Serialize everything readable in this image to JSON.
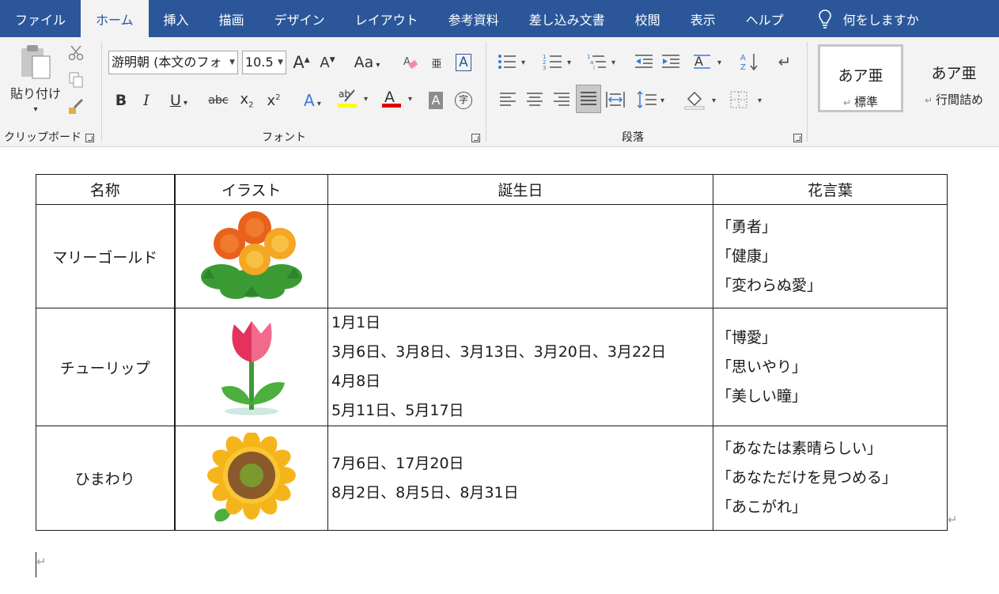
{
  "tabs": [
    {
      "label": "ファイル",
      "active": false
    },
    {
      "label": "ホーム",
      "active": true
    },
    {
      "label": "挿入",
      "active": false
    },
    {
      "label": "描画",
      "active": false
    },
    {
      "label": "デザイン",
      "active": false
    },
    {
      "label": "レイアウト",
      "active": false
    },
    {
      "label": "参考資料",
      "active": false
    },
    {
      "label": "差し込み文書",
      "active": false
    },
    {
      "label": "校閲",
      "active": false
    },
    {
      "label": "表示",
      "active": false
    },
    {
      "label": "ヘルプ",
      "active": false
    }
  ],
  "tell_me": {
    "label": "何をしますか",
    "icon": "lightbulb-icon"
  },
  "ribbon": {
    "clipboard": {
      "label": "クリップボード",
      "paste_label": "貼り付け"
    },
    "font": {
      "label": "フォント",
      "font_name": "游明朝 (本文のフォ",
      "font_size": "10.5"
    },
    "paragraph": {
      "label": "段落"
    },
    "styles": [
      {
        "preview": "あア亜",
        "name": "標準",
        "selected": true
      },
      {
        "preview": "あア亜",
        "name": "行間詰め",
        "selected": false
      }
    ]
  },
  "colors": {
    "tabbar": "#2b579a",
    "highlight": "#ffff00",
    "font_color": "#e00000"
  },
  "table": {
    "headers": [
      "名称",
      "イラスト",
      "誕生日",
      "花言葉"
    ],
    "rows": [
      {
        "name": "マリーゴールド",
        "illustration": "marigold-illustration",
        "birthdays": [],
        "words": [
          "「勇者」",
          "「健康」",
          "「変わらぬ愛」"
        ]
      },
      {
        "name": "チューリップ",
        "illustration": "tulip-illustration",
        "birthdays": [
          "1月1日",
          "3月6日、3月8日、3月13日、3月20日、3月22日",
          "4月8日",
          "5月11日、5月17日"
        ],
        "words": [
          "「博愛」",
          "「思いやり」",
          "「美しい瞳」"
        ]
      },
      {
        "name": "ひまわり",
        "illustration": "sunflower-illustration",
        "birthdays": [
          "7月6日、17月20日",
          "8月2日、8月5日、8月31日"
        ],
        "words": [
          "「あなたは素晴らしい」",
          "「あなただけを見つめる」",
          "「あこがれ」"
        ]
      }
    ]
  },
  "paragraph_mark": "↵"
}
